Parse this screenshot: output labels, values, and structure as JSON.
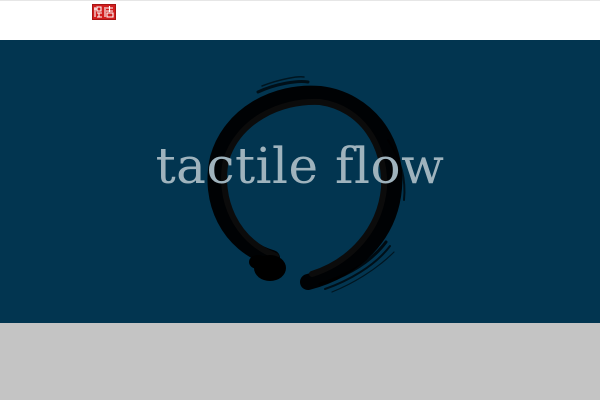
{
  "header": {
    "logo_icon": "red-seal-stamp-icon",
    "logo_color": "#d21f1f"
  },
  "hero": {
    "title": "tactile flow",
    "background_color": "#023550",
    "title_color": "#9fb3bd",
    "brush_icon": "enso-circle-icon"
  },
  "footer": {
    "band_color": "#c4c4c4"
  }
}
